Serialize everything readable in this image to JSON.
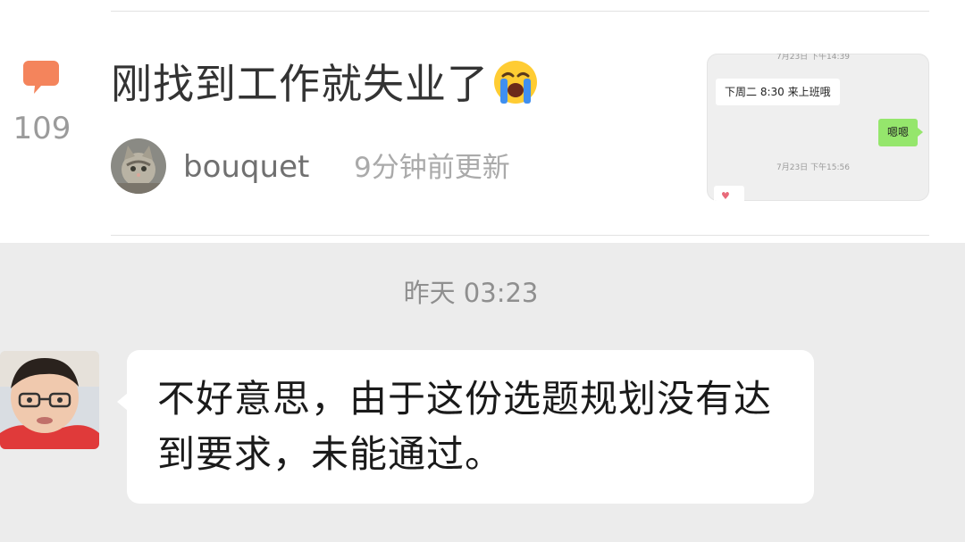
{
  "feed_item": {
    "comment_count": "109",
    "title": "刚找到工作就失业了",
    "title_emoji": "loudly-crying-face-emoji",
    "author": "bouquet",
    "updated": "9分钟前更新",
    "thumbnail": {
      "timestamp_top": "7月23日 下午14:39",
      "message_left": "下周二 8:30 来上班哦",
      "message_right": "嗯嗯",
      "timestamp_bottom": "7月23日 下午15:56"
    }
  },
  "chat": {
    "timestamp": "昨天 03:23",
    "message": "不好意思，由于这份选题规划没有达到要求，未能通过。"
  },
  "colors": {
    "accent_orange": "#f4845c",
    "chat_background": "#ececec",
    "wechat_green": "#95e66c"
  },
  "icons": [
    "comment-icon",
    "loudly-crying-face-emoji",
    "heart-icon"
  ]
}
